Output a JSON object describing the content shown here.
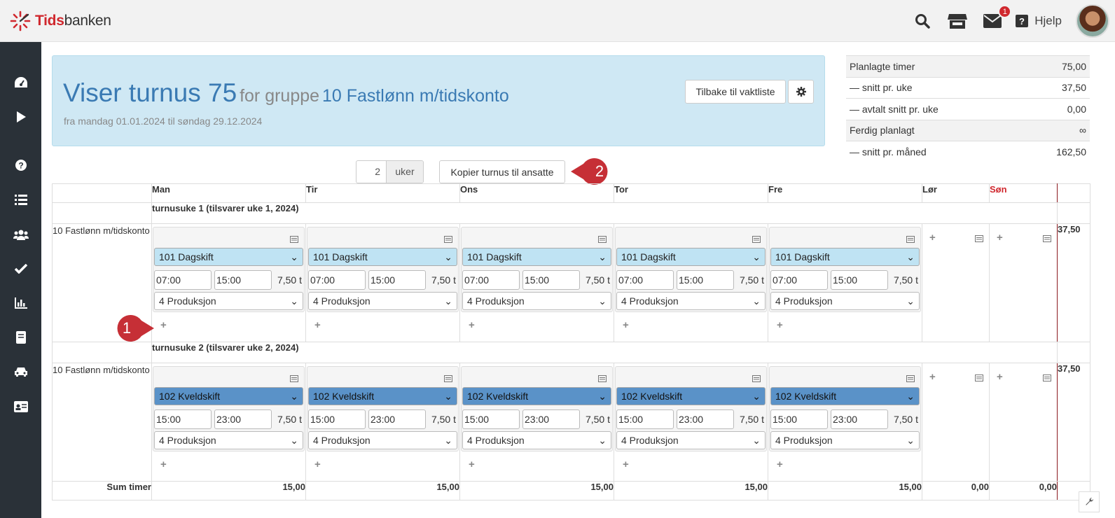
{
  "app": {
    "logo_red": "Tids",
    "logo_rest": "banken",
    "help_label": "Hjelp",
    "message_count": "1"
  },
  "header": {
    "title_big": "Viser turnus 75",
    "title_mid": "for gruppe",
    "title_group": "10 Fastlønn m/tidskonto",
    "subtitle": "fra mandag 01.01.2024 til søndag 29.12.2024",
    "back_button": "Tilbake til vaktliste"
  },
  "stats": [
    {
      "label": "Planlagte timer",
      "value": "75,00"
    },
    {
      "label": "— snitt pr. uke",
      "value": "37,50"
    },
    {
      "label": "— avtalt snitt pr. uke",
      "value": "0,00"
    },
    {
      "label": "Ferdig planlagt",
      "value": "∞"
    },
    {
      "label": "— snitt pr. måned",
      "value": "162,50"
    }
  ],
  "controls": {
    "weeks_value": "2",
    "weeks_unit": "uker",
    "copy_button": "Kopier turnus til ansatte"
  },
  "callouts": {
    "one": "1",
    "two": "2"
  },
  "days": [
    "Man",
    "Tir",
    "Ons",
    "Tor",
    "Fre",
    "Lør",
    "Søn"
  ],
  "colors": {
    "sunday": "#d0282e",
    "day_shift": "#bfe3f3",
    "evening_shift": "#5a92c8",
    "header_bg": "#cfe8f4",
    "sidebar": "#2a3138"
  },
  "weeks": [
    {
      "title": "turnusuke 1 (tilsvarer uke 1, 2024)",
      "group": "10 Fastlønn m/tidskonto",
      "shift": "101 Dagskift",
      "from": "07:00",
      "to": "15:00",
      "hours": "7,50 t",
      "dept": "4 Produksjon",
      "total": "37,50"
    },
    {
      "title": "turnusuke 2 (tilsvarer uke 2, 2024)",
      "group": "10 Fastlønn m/tidskonto",
      "shift": "102 Kveldskift",
      "from": "15:00",
      "to": "23:00",
      "hours": "7,50 t",
      "dept": "4 Produksjon",
      "total": "37,50"
    }
  ],
  "sum": {
    "label": "Sum timer",
    "values": [
      "15,00",
      "15,00",
      "15,00",
      "15,00",
      "15,00",
      "0,00",
      "0,00"
    ]
  }
}
